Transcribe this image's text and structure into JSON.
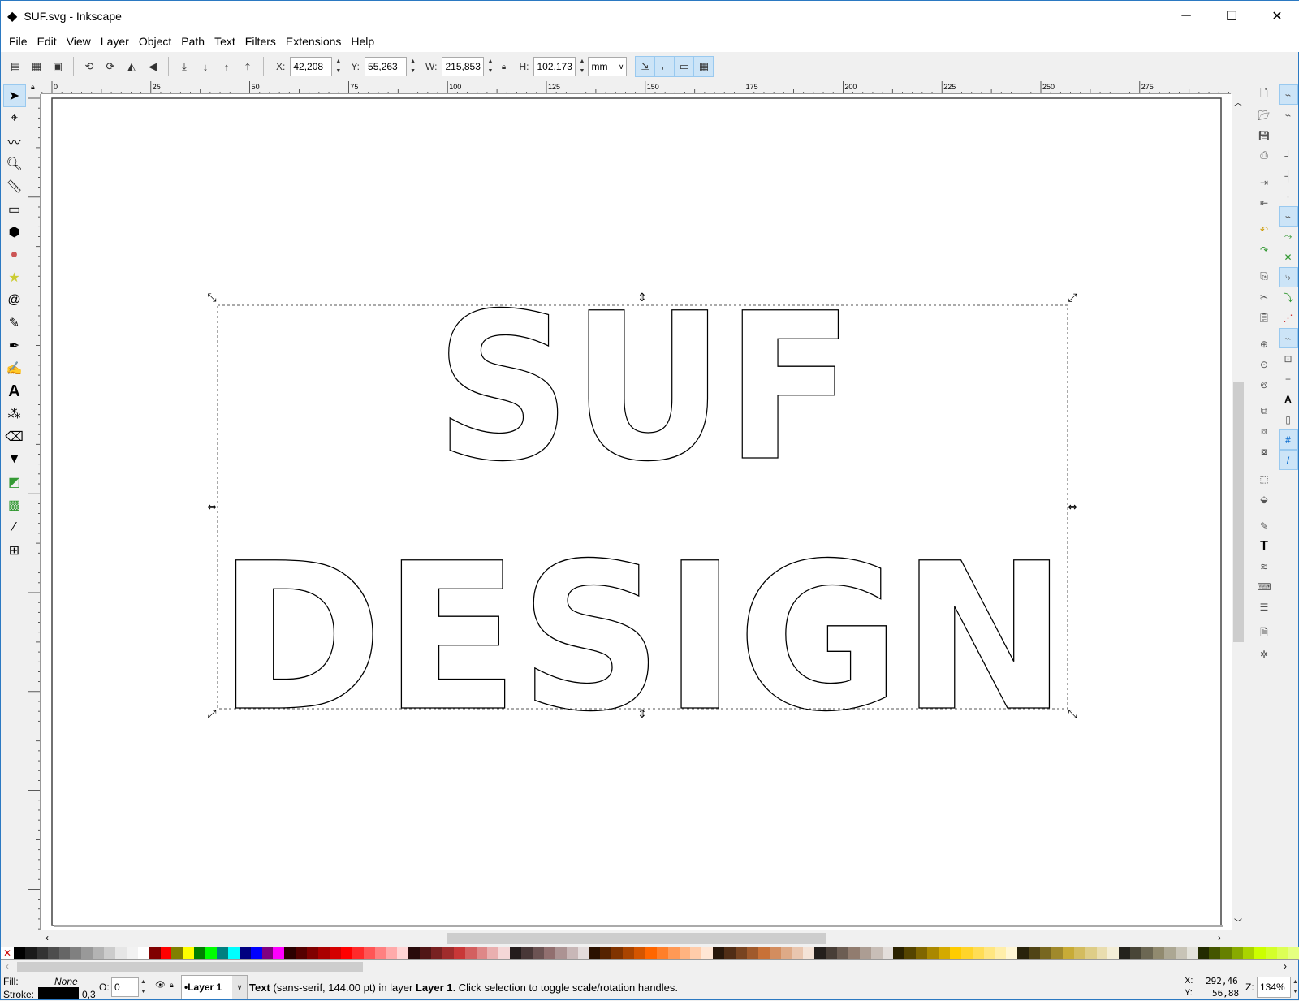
{
  "window": {
    "title": "SUF.svg - Inkscape",
    "minimize": "─",
    "maximize": "☐",
    "close": "✕"
  },
  "menu": [
    "File",
    "Edit",
    "View",
    "Layer",
    "Object",
    "Path",
    "Text",
    "Filters",
    "Extensions",
    "Help"
  ],
  "toolbar": {
    "x_label": "X:",
    "x": "42,208",
    "y_label": "Y:",
    "y": "55,263",
    "w_label": "W:",
    "w": "215,853",
    "h_label": "H:",
    "h": "102,173",
    "unit": "mm"
  },
  "ruler": {
    "h_labels": [
      "0",
      "25",
      "50",
      "75",
      "100",
      "125",
      "150",
      "175",
      "200",
      "225",
      "250",
      "275"
    ]
  },
  "canvas": {
    "line1": "SUF",
    "line2": "DESIGN"
  },
  "statusbar": {
    "fill_label": "Fill:",
    "fill_value": "None",
    "stroke_label": "Stroke:",
    "stroke_width": "0,3",
    "opacity_label": "O:",
    "opacity": "0",
    "layer": "•Layer 1",
    "message_bold": "Text",
    "message_1": " (sans-serif, 144.00 pt) in layer ",
    "message_layer": "Layer 1",
    "message_2": ". Click selection to toggle scale/rotation handles.",
    "x_label": "X:",
    "x": "292,46",
    "y_label": "Y:",
    "y": "56,88",
    "zoom_label": "Z:",
    "zoom": "134%"
  },
  "palette": [
    "#000000",
    "#1a1a1a",
    "#333333",
    "#4d4d4d",
    "#666666",
    "#808080",
    "#999999",
    "#b3b3b3",
    "#cccccc",
    "#e6e6e6",
    "#f2f2f2",
    "#ffffff",
    "#800000",
    "#ff0000",
    "#808000",
    "#ffff00",
    "#008000",
    "#00ff00",
    "#008080",
    "#00ffff",
    "#000080",
    "#0000ff",
    "#800080",
    "#ff00ff",
    "#2b0000",
    "#550000",
    "#800000",
    "#aa0000",
    "#d40000",
    "#ff0000",
    "#ff2a2a",
    "#ff5555",
    "#ff8080",
    "#ffaaaa",
    "#ffd5d5",
    "#280b0b",
    "#501616",
    "#782121",
    "#a02c2c",
    "#c83737",
    "#d35f5f",
    "#de8787",
    "#e9afaf",
    "#f4d7d7",
    "#241c1c",
    "#483737",
    "#6c5353",
    "#916f6f",
    "#ac9393",
    "#c8b7b7",
    "#e3dbdb",
    "#2b1100",
    "#552200",
    "#803300",
    "#aa4400",
    "#d45500",
    "#ff6600",
    "#ff7f2a",
    "#ff9955",
    "#ffb380",
    "#ffccaa",
    "#ffe6d5",
    "#28170b",
    "#502d16",
    "#784421",
    "#a05a2c",
    "#c87137",
    "#d38d5f",
    "#deaa87",
    "#e9c6af",
    "#f4e3d7",
    "#241f1c",
    "#483e37",
    "#6c5d53",
    "#917c6f",
    "#ac9d93",
    "#c8beb7",
    "#e3dedb",
    "#2b2200",
    "#554400",
    "#806600",
    "#aa8800",
    "#d4aa00",
    "#ffcc00",
    "#ffd42a",
    "#ffdd55",
    "#ffe680",
    "#ffeeaa",
    "#fff6d5",
    "#28220b",
    "#504416",
    "#786721",
    "#a0892c",
    "#c8ab37",
    "#d3bc5f",
    "#decd87",
    "#e9ddaf",
    "#f4eed7",
    "#24221c",
    "#484537",
    "#6c6753",
    "#918a6f",
    "#aca793",
    "#c8c4b7",
    "#e3e2db",
    "#222b00",
    "#445500",
    "#668000",
    "#88aa00",
    "#aad400",
    "#ccff00",
    "#d4ff2a",
    "#ddff55",
    "#e5ff80"
  ],
  "colors": {
    "accent": "#cce4f7",
    "accent_border": "#99c9ef"
  }
}
